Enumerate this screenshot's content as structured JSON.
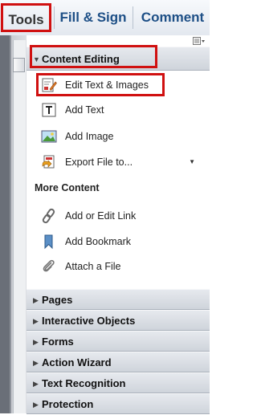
{
  "tabs": {
    "tools": "Tools",
    "fill_sign": "Fill & Sign",
    "comment": "Comment"
  },
  "panel": {
    "options_icon": "panel-options-icon",
    "content_editing": {
      "title": "Content Editing",
      "items": [
        {
          "label": "Edit Text & Images",
          "icon": "edit-text-images-icon"
        },
        {
          "label": "Add Text",
          "icon": "add-text-icon"
        },
        {
          "label": "Add Image",
          "icon": "add-image-icon"
        },
        {
          "label": "Export File to...",
          "icon": "export-file-icon"
        }
      ]
    },
    "more_content": {
      "title": "More Content",
      "items": [
        {
          "label": "Add or Edit Link",
          "icon": "link-icon"
        },
        {
          "label": "Add Bookmark",
          "icon": "bookmark-icon"
        },
        {
          "label": "Attach a File",
          "icon": "paperclip-icon"
        }
      ]
    },
    "sections": [
      {
        "label": "Pages"
      },
      {
        "label": "Interactive Objects"
      },
      {
        "label": "Forms"
      },
      {
        "label": "Action Wizard"
      },
      {
        "label": "Text Recognition"
      },
      {
        "label": "Protection"
      }
    ]
  },
  "colors": {
    "highlight": "#d01010",
    "tab_text": "#1d4f86"
  }
}
